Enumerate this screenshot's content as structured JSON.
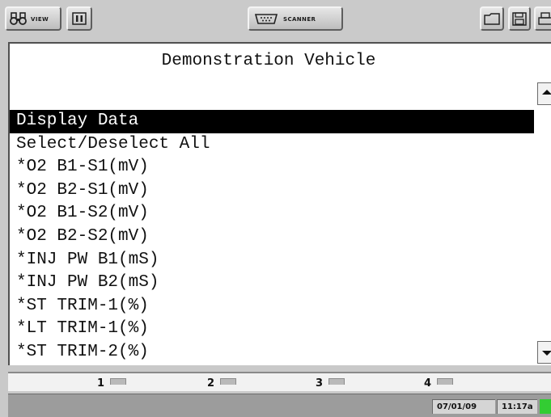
{
  "toolbar": {
    "view_label": "VIEW",
    "scanner_label": "SCANNER",
    "icons": [
      "binoculars-icon",
      "pause-icon",
      "scanner-cable-icon",
      "folder-icon",
      "save-icon",
      "print-icon"
    ]
  },
  "screen": {
    "title": "Demonstration Vehicle",
    "menu_items": [
      {
        "label": "Display Data",
        "selected": true
      },
      {
        "label": "Select/Deselect All"
      },
      {
        "label": "*O2 B1-S1(mV)"
      },
      {
        "label": "*O2 B2-S1(mV)"
      },
      {
        "label": "*O2 B1-S2(mV)"
      },
      {
        "label": "*O2 B2-S2(mV)"
      },
      {
        "label": "*INJ PW B1(mS)"
      },
      {
        "label": "*INJ PW B2(mS)"
      },
      {
        "label": "*ST TRIM-1(%)"
      },
      {
        "label": "*LT TRIM-1(%)"
      },
      {
        "label": "*ST TRIM-2(%)"
      }
    ]
  },
  "function_keys": [
    "1",
    "2",
    "3",
    "4"
  ],
  "status": {
    "date": "07/01/09",
    "time": "11:17a",
    "battery_color": "#33cc33"
  },
  "colors": {
    "selection_bg": "#000000",
    "screen_bg": "#ffffff",
    "frame_bg": "#c9c9c9"
  }
}
